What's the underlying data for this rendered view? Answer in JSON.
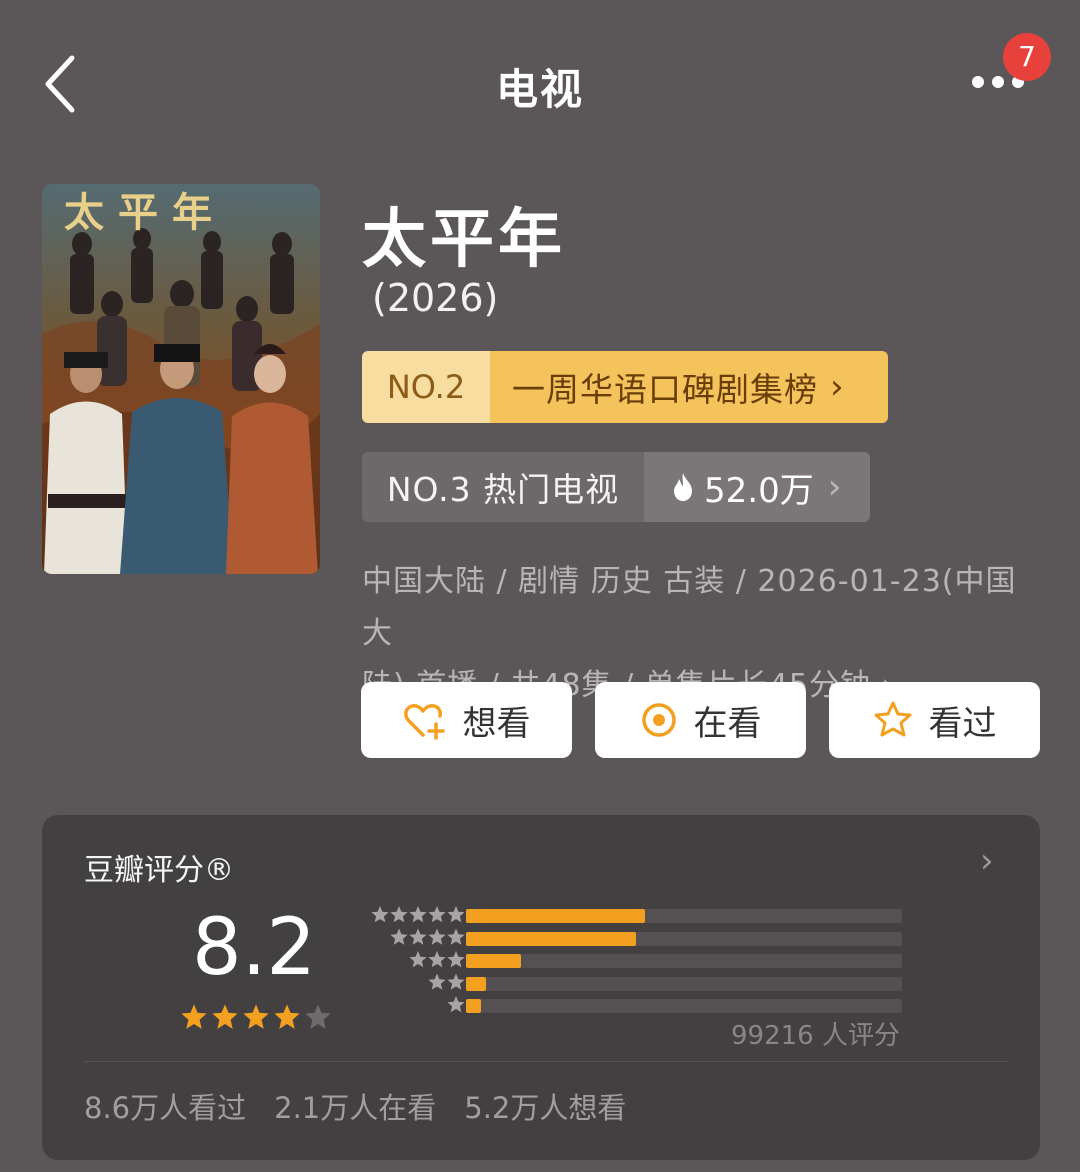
{
  "header": {
    "title": "电视",
    "notification_count": "7",
    "icons": [
      "back-chevron-icon",
      "more-dots-icon"
    ]
  },
  "movie": {
    "poster_title": "太平年",
    "title": "太平年",
    "year": "(2026)",
    "rank_primary": {
      "number": "NO.2",
      "list_name": "一周华语口碑剧集榜"
    },
    "rank_secondary": {
      "label": "NO.3 热门电视",
      "heat": "52.0万"
    },
    "meta_line1": "中国大陆 / 剧情 历史 古装 / 2026-01-23(中国大",
    "meta_line2": "陆) 首播 / 共48集 / 单集片长45分钟"
  },
  "actions": [
    {
      "label": "想看",
      "icon": "heart-plus-icon"
    },
    {
      "label": "在看",
      "icon": "target-icon"
    },
    {
      "label": "看过",
      "icon": "star-outline-icon"
    }
  ],
  "rating": {
    "heading": "豆瓣评分®",
    "score": "8.2",
    "stars_filled": 4,
    "stars_total": 5,
    "distribution": [
      {
        "stars": 5,
        "fraction": 0.41
      },
      {
        "stars": 4,
        "fraction": 0.39
      },
      {
        "stars": 3,
        "fraction": 0.125
      },
      {
        "stars": 2,
        "fraction": 0.045
      },
      {
        "stars": 1,
        "fraction": 0.035
      }
    ],
    "total_raters": "99216 人评分",
    "stats": [
      "8.6万人看过",
      "2.1万人在看",
      "5.2万人想看"
    ]
  },
  "colors": {
    "background": "#5b5658",
    "accent_orange": "#f3a021",
    "rank_gold": "#f5c35b",
    "badge_red": "#e8413b"
  }
}
